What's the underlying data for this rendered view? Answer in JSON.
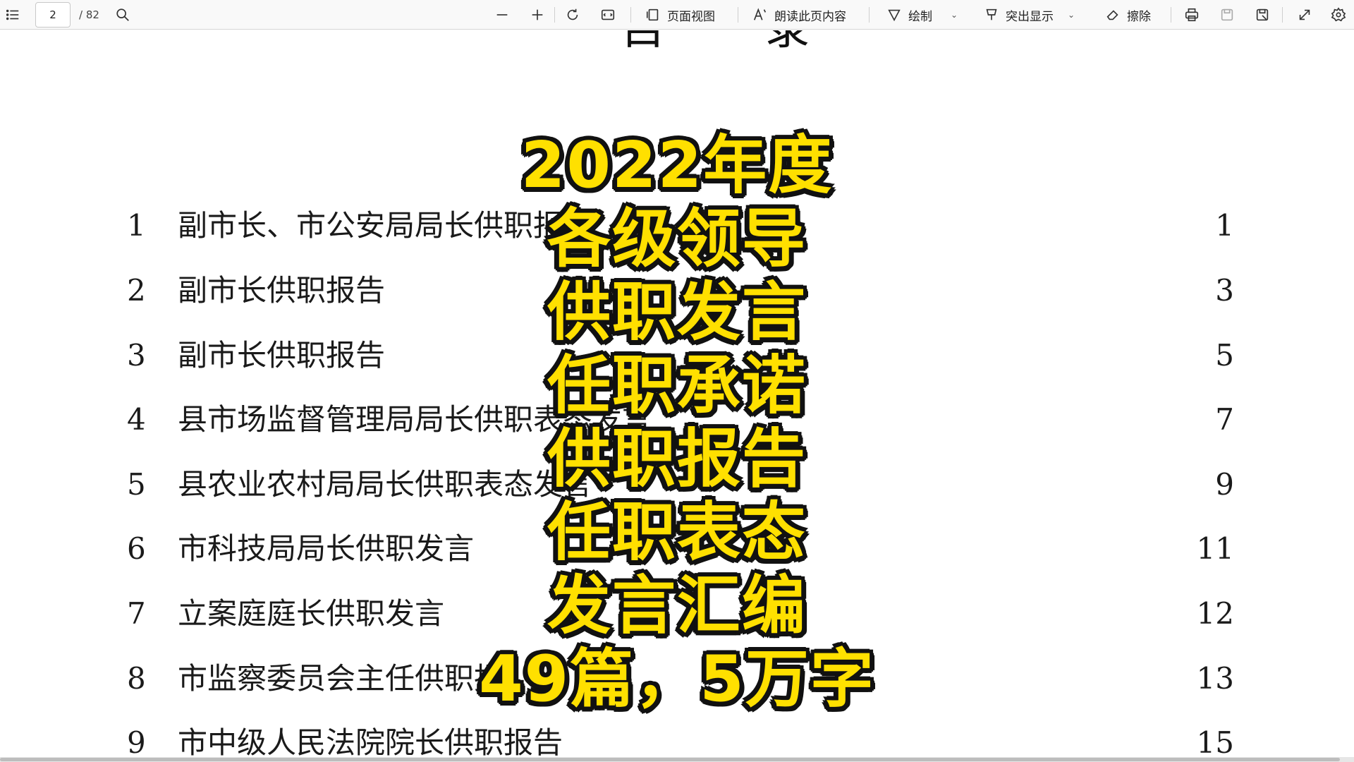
{
  "toolbar": {
    "current_page": "2",
    "total_pages": "/ 82",
    "page_view_label": "页面视图",
    "read_aloud_label": "朗读此页内容",
    "draw_label": "绘制",
    "highlight_label": "突出显示",
    "erase_label": "擦除",
    "icons": [
      "list-icon",
      "search-icon",
      "zoom-out-icon",
      "zoom-in-icon",
      "rotate-icon",
      "fit-width-icon",
      "page-view-icon",
      "read-aloud-icon",
      "draw-icon",
      "highlight-icon",
      "eraser-icon",
      "print-icon",
      "save-icon",
      "save-as-icon",
      "fullscreen-icon",
      "settings-icon"
    ]
  },
  "document": {
    "heading": "目 录",
    "toc": [
      {
        "num": "1",
        "title": "副市长、市公安局局长供职报",
        "page": "1"
      },
      {
        "num": "2",
        "title": "副市长供职报告",
        "page": "3"
      },
      {
        "num": "3",
        "title": "副市长供职报告",
        "page": "5"
      },
      {
        "num": "4",
        "title": "县市场监督管理局局长供职表态发言",
        "page": "7"
      },
      {
        "num": "5",
        "title": "县农业农村局局长供职表态发言",
        "page": "9"
      },
      {
        "num": "6",
        "title": "市科技局局长供职发言",
        "page": "11"
      },
      {
        "num": "7",
        "title": "立案庭庭长供职发言",
        "page": "12"
      },
      {
        "num": "8",
        "title": "市监察委员会主任供职报",
        "page": "13"
      },
      {
        "num": "9",
        "title": "市中级人民法院院长供职报告",
        "page": "15"
      }
    ]
  },
  "overlay": {
    "lines": [
      "2022年度",
      "各级领导",
      "供职发言",
      "任职承诺",
      "供职报告",
      "任职表态",
      "发言汇编",
      "49篇，5万字"
    ],
    "text_color": "#ffe000",
    "outline_color": "#111111"
  }
}
